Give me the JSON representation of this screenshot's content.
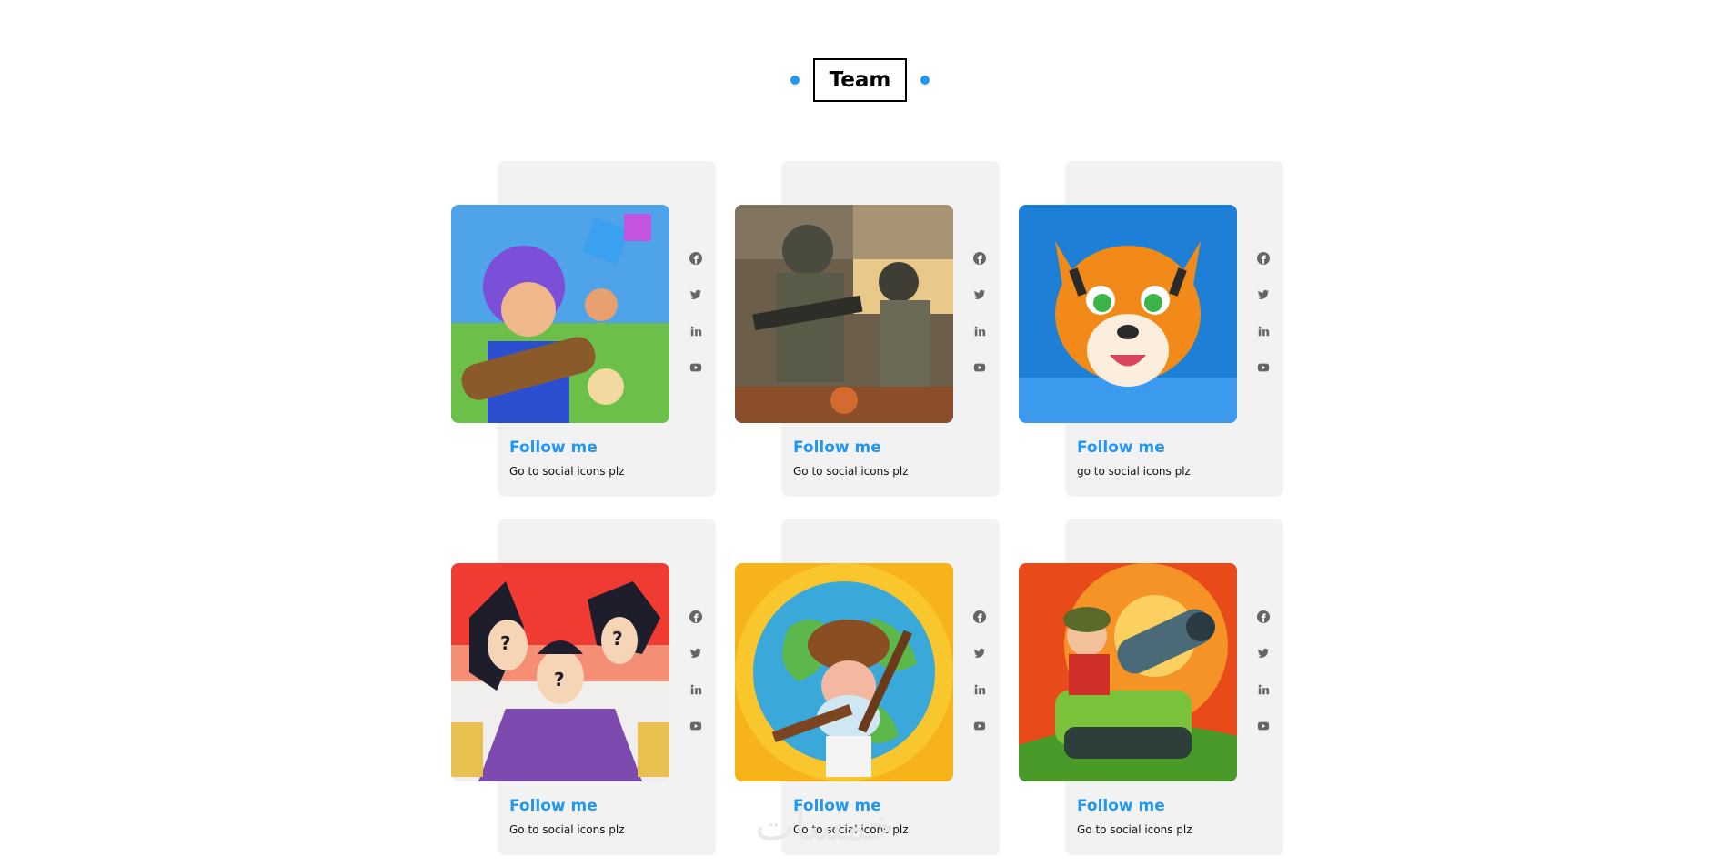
{
  "section": {
    "title": "Team",
    "accent_color": "#2196f3"
  },
  "members": [
    {
      "name": "Follow me",
      "description": "Go to social icons plz",
      "image": "pixel-hero-with-bazooka"
    },
    {
      "name": "Follow me",
      "description": "Go to social icons plz",
      "image": "armed-soldiers"
    },
    {
      "name": "Follow me",
      "description": "go to social icons plz",
      "image": "cartoon-tiger"
    },
    {
      "name": "Follow me",
      "description": "Go to social icons plz",
      "image": "anime-silhouette-quiz"
    },
    {
      "name": "Follow me",
      "description": "Go to social icons plz",
      "image": "miner-on-globe"
    },
    {
      "name": "Follow me",
      "description": "Go to social icons plz",
      "image": "cartoon-tank"
    }
  ],
  "socials": [
    "facebook-icon",
    "twitter-icon",
    "linkedin-icon",
    "youtube-icon"
  ],
  "watermark": "خمسات"
}
